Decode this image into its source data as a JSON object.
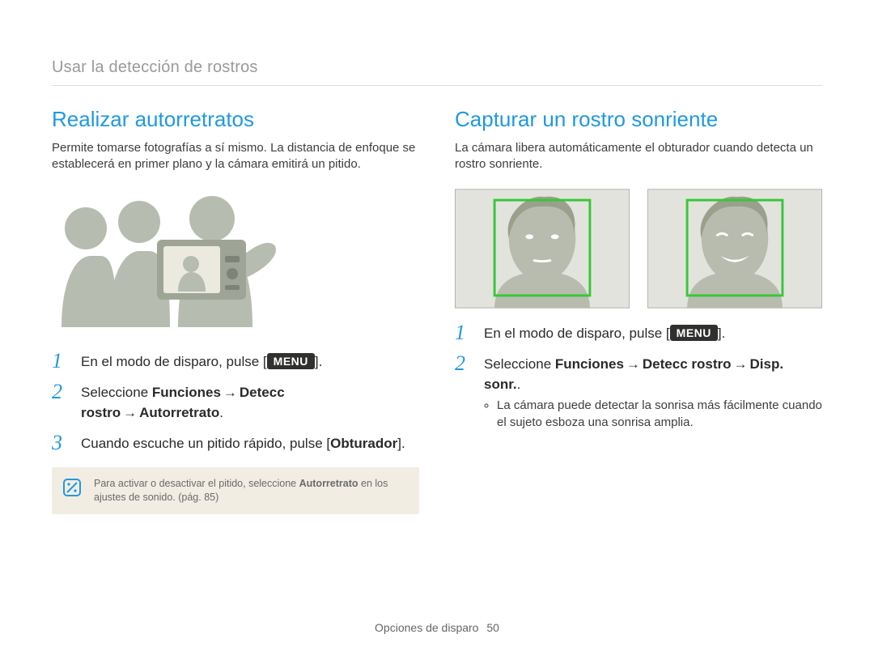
{
  "breadcrumb": "Usar la detección de rostros",
  "left": {
    "title": "Realizar autorretratos",
    "lead": "Permite tomarse fotografías a sí mismo. La distancia de enfoque se establecerá en primer plano y la cámara emitirá un pitido.",
    "step1_pre": "En el modo de disparo, pulse [",
    "menu_label": "MENU",
    "step1_post": "].",
    "step2_a": "Seleccione ",
    "step2_b": "Funciones",
    "step2_c": "Detecc rostro",
    "step2_d": "Autorretrato",
    "step3_a": "Cuando escuche un pitido rápido, pulse [",
    "step3_b": "Obturador",
    "step3_c": "].",
    "note_a": "Para activar o desactivar el pitido, seleccione ",
    "note_b": "Autorretrato",
    "note_c": " en los ajustes de sonido. (pág. 85)"
  },
  "right": {
    "title": "Capturar un rostro sonriente",
    "lead": "La cámara libera automáticamente el obturador cuando detecta un rostro sonriente.",
    "step1_pre": "En el modo de disparo, pulse [",
    "menu_label": "MENU",
    "step1_post": "].",
    "step2_a": "Seleccione ",
    "step2_b": "Funciones",
    "step2_c": "Detecc rostro",
    "step2_d": "Disp. sonr.",
    "step2_e": ".",
    "bullet": "La cámara puede detectar la sonrisa más fácilmente cuando el sujeto esboza una sonrisa amplia."
  },
  "arrow": "→",
  "nums": {
    "one": "1",
    "two": "2",
    "three": "3"
  },
  "footer": {
    "label": "Opciones de disparo",
    "page": "50"
  }
}
